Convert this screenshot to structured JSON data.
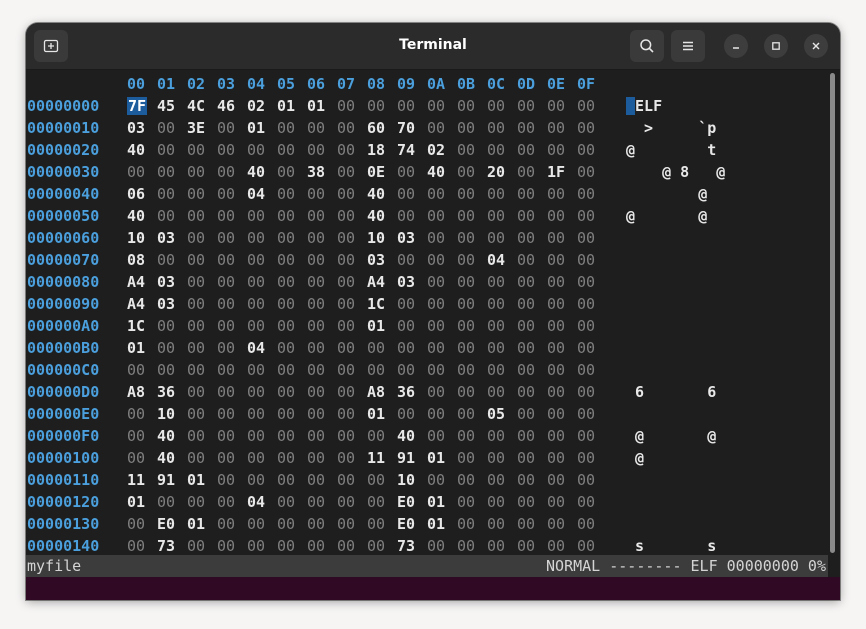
{
  "window": {
    "title": "Terminal"
  },
  "hexview": {
    "column_headers": [
      "00",
      "01",
      "02",
      "03",
      "04",
      "05",
      "06",
      "07",
      "08",
      "09",
      "0A",
      "0B",
      "0C",
      "0D",
      "0E",
      "0F"
    ],
    "rows": [
      {
        "addr": "00000000",
        "bytes": [
          "7F",
          "45",
          "4C",
          "46",
          "02",
          "01",
          "01",
          "00",
          "00",
          "00",
          "00",
          "00",
          "00",
          "00",
          "00",
          "00"
        ],
        "ascii": "ELF"
      },
      {
        "addr": "00000010",
        "bytes": [
          "03",
          "00",
          "3E",
          "00",
          "01",
          "00",
          "00",
          "00",
          "60",
          "70",
          "00",
          "00",
          "00",
          "00",
          "00",
          "00"
        ],
        "ascii": "  >     `p"
      },
      {
        "addr": "00000020",
        "bytes": [
          "40",
          "00",
          "00",
          "00",
          "00",
          "00",
          "00",
          "00",
          "18",
          "74",
          "02",
          "00",
          "00",
          "00",
          "00",
          "00"
        ],
        "ascii": "@        t"
      },
      {
        "addr": "00000030",
        "bytes": [
          "00",
          "00",
          "00",
          "00",
          "40",
          "00",
          "38",
          "00",
          "0E",
          "00",
          "40",
          "00",
          "20",
          "00",
          "1F",
          "00"
        ],
        "ascii": "    @ 8   @"
      },
      {
        "addr": "00000040",
        "bytes": [
          "06",
          "00",
          "00",
          "00",
          "04",
          "00",
          "00",
          "00",
          "40",
          "00",
          "00",
          "00",
          "00",
          "00",
          "00",
          "00"
        ],
        "ascii": "        @"
      },
      {
        "addr": "00000050",
        "bytes": [
          "40",
          "00",
          "00",
          "00",
          "00",
          "00",
          "00",
          "00",
          "40",
          "00",
          "00",
          "00",
          "00",
          "00",
          "00",
          "00"
        ],
        "ascii": "@       @"
      },
      {
        "addr": "00000060",
        "bytes": [
          "10",
          "03",
          "00",
          "00",
          "00",
          "00",
          "00",
          "00",
          "10",
          "03",
          "00",
          "00",
          "00",
          "00",
          "00",
          "00"
        ],
        "ascii": ""
      },
      {
        "addr": "00000070",
        "bytes": [
          "08",
          "00",
          "00",
          "00",
          "00",
          "00",
          "00",
          "00",
          "03",
          "00",
          "00",
          "00",
          "04",
          "00",
          "00",
          "00"
        ],
        "ascii": ""
      },
      {
        "addr": "00000080",
        "bytes": [
          "A4",
          "03",
          "00",
          "00",
          "00",
          "00",
          "00",
          "00",
          "A4",
          "03",
          "00",
          "00",
          "00",
          "00",
          "00",
          "00"
        ],
        "ascii": ""
      },
      {
        "addr": "00000090",
        "bytes": [
          "A4",
          "03",
          "00",
          "00",
          "00",
          "00",
          "00",
          "00",
          "1C",
          "00",
          "00",
          "00",
          "00",
          "00",
          "00",
          "00"
        ],
        "ascii": ""
      },
      {
        "addr": "000000A0",
        "bytes": [
          "1C",
          "00",
          "00",
          "00",
          "00",
          "00",
          "00",
          "00",
          "01",
          "00",
          "00",
          "00",
          "00",
          "00",
          "00",
          "00"
        ],
        "ascii": ""
      },
      {
        "addr": "000000B0",
        "bytes": [
          "01",
          "00",
          "00",
          "00",
          "04",
          "00",
          "00",
          "00",
          "00",
          "00",
          "00",
          "00",
          "00",
          "00",
          "00",
          "00"
        ],
        "ascii": ""
      },
      {
        "addr": "000000C0",
        "bytes": [
          "00",
          "00",
          "00",
          "00",
          "00",
          "00",
          "00",
          "00",
          "00",
          "00",
          "00",
          "00",
          "00",
          "00",
          "00",
          "00"
        ],
        "ascii": ""
      },
      {
        "addr": "000000D0",
        "bytes": [
          "A8",
          "36",
          "00",
          "00",
          "00",
          "00",
          "00",
          "00",
          "A8",
          "36",
          "00",
          "00",
          "00",
          "00",
          "00",
          "00"
        ],
        "ascii": " 6       6"
      },
      {
        "addr": "000000E0",
        "bytes": [
          "00",
          "10",
          "00",
          "00",
          "00",
          "00",
          "00",
          "00",
          "01",
          "00",
          "00",
          "00",
          "05",
          "00",
          "00",
          "00"
        ],
        "ascii": ""
      },
      {
        "addr": "000000F0",
        "bytes": [
          "00",
          "40",
          "00",
          "00",
          "00",
          "00",
          "00",
          "00",
          "00",
          "40",
          "00",
          "00",
          "00",
          "00",
          "00",
          "00"
        ],
        "ascii": " @       @"
      },
      {
        "addr": "00000100",
        "bytes": [
          "00",
          "40",
          "00",
          "00",
          "00",
          "00",
          "00",
          "00",
          "11",
          "91",
          "01",
          "00",
          "00",
          "00",
          "00",
          "00"
        ],
        "ascii": " @"
      },
      {
        "addr": "00000110",
        "bytes": [
          "11",
          "91",
          "01",
          "00",
          "00",
          "00",
          "00",
          "00",
          "00",
          "10",
          "00",
          "00",
          "00",
          "00",
          "00",
          "00"
        ],
        "ascii": ""
      },
      {
        "addr": "00000120",
        "bytes": [
          "01",
          "00",
          "00",
          "00",
          "04",
          "00",
          "00",
          "00",
          "00",
          "E0",
          "01",
          "00",
          "00",
          "00",
          "00",
          "00"
        ],
        "ascii": ""
      },
      {
        "addr": "00000130",
        "bytes": [
          "00",
          "E0",
          "01",
          "00",
          "00",
          "00",
          "00",
          "00",
          "00",
          "E0",
          "01",
          "00",
          "00",
          "00",
          "00",
          "00"
        ],
        "ascii": ""
      },
      {
        "addr": "00000140",
        "bytes": [
          "00",
          "73",
          "00",
          "00",
          "00",
          "00",
          "00",
          "00",
          "00",
          "73",
          "00",
          "00",
          "00",
          "00",
          "00",
          "00"
        ],
        "ascii": " s       s"
      }
    ]
  },
  "statusbar": {
    "filename": "myfile",
    "info": "NORMAL -------- ELF 00000000 0%"
  }
}
